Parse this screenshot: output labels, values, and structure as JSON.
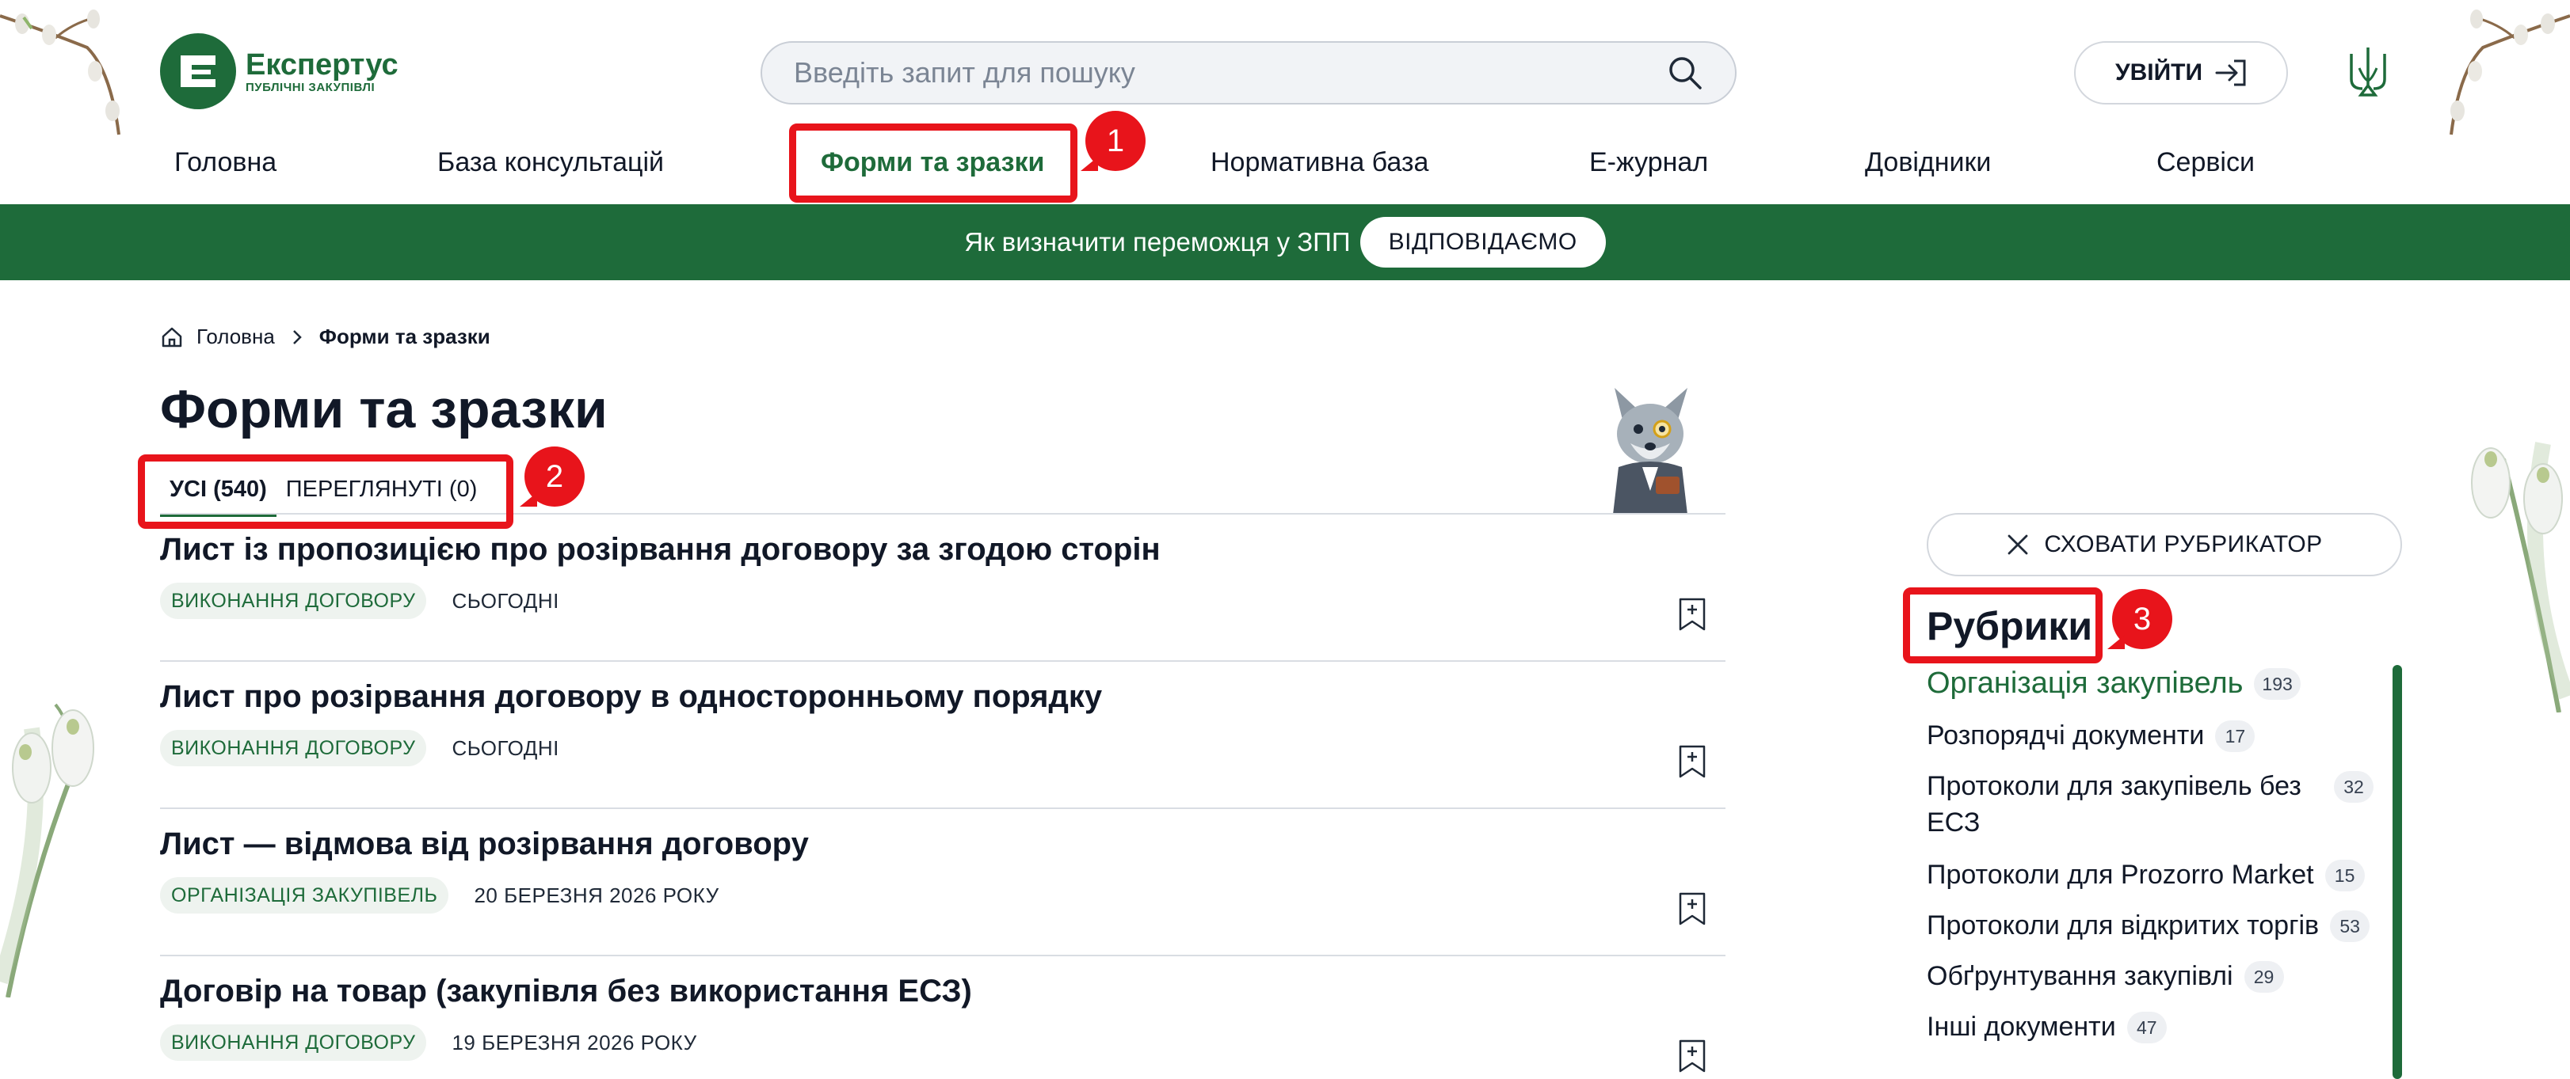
{
  "header": {
    "logo": {
      "name": "Експертус",
      "subtitle": "ПУБЛІЧНІ ЗАКУПІВЛІ"
    },
    "search": {
      "placeholder": "Введіть запит для пошуку"
    },
    "login_label": "УВІЙТИ"
  },
  "nav": [
    {
      "label": "Головна"
    },
    {
      "label": "База консультацій"
    },
    {
      "label": "Форми та зразки",
      "active": true
    },
    {
      "label": "Нормативна база"
    },
    {
      "label": "Е-журнал"
    },
    {
      "label": "Довідники"
    },
    {
      "label": "Сервіси"
    }
  ],
  "banner": {
    "text": "Як визначити переможця у ЗПП",
    "button": "ВІДПОВІДАЄМО"
  },
  "breadcrumb": {
    "home": "Головна",
    "current": "Форми та зразки"
  },
  "page": {
    "title": "Форми та зразки"
  },
  "tabs": [
    {
      "label": "УСІ (540)",
      "active": true
    },
    {
      "label": "ПЕРЕГЛЯНУТІ (0)"
    }
  ],
  "items": [
    {
      "title": "Лист із пропозицією про розірвання договору за згодою сторін",
      "tag": "ВИКОНАННЯ ДОГОВОРУ",
      "date": "СЬОГОДНІ"
    },
    {
      "title": "Лист про розірвання договору в односторонньому порядку",
      "tag": "ВИКОНАННЯ ДОГОВОРУ",
      "date": "СЬОГОДНІ"
    },
    {
      "title": "Лист — відмова від розірвання договору",
      "tag": "ОРГАНІЗАЦІЯ ЗАКУПІВЕЛЬ",
      "date": "20 БЕРЕЗНЯ 2026 РОКУ"
    },
    {
      "title": "Договір на товар (закупівля без використання ЕСЗ)",
      "tag": "ВИКОНАННЯ ДОГОВОРУ",
      "date": "19 БЕРЕЗНЯ 2026 РОКУ"
    }
  ],
  "sidebar": {
    "hide_button": "СХОВАТИ РУБРИКАТОР",
    "title": "Рубрики",
    "rubrics": [
      {
        "label": "Організація закупівель",
        "count": "193",
        "active": true
      },
      {
        "label": "Розпорядчі документи",
        "count": "17"
      },
      {
        "label": "Протоколи для закупівель без ЕСЗ",
        "count": "32"
      },
      {
        "label": "Протоколи для Prozorro Market",
        "count": "15"
      },
      {
        "label": "Протоколи для відкритих торгів",
        "count": "53"
      },
      {
        "label": "Обґрунтування закупівлі",
        "count": "29"
      },
      {
        "label": "Інші документи",
        "count": "47"
      }
    ]
  },
  "annotations": [
    {
      "number": "1"
    },
    {
      "number": "2"
    },
    {
      "number": "3"
    }
  ],
  "colors": {
    "brand": "#1e6b3a",
    "highlight": "#e8141b"
  },
  "icons": [
    "search-icon",
    "login-arrow-icon",
    "trident-icon",
    "home-icon",
    "chevron-right-icon",
    "bookmark-add-icon",
    "close-icon"
  ]
}
